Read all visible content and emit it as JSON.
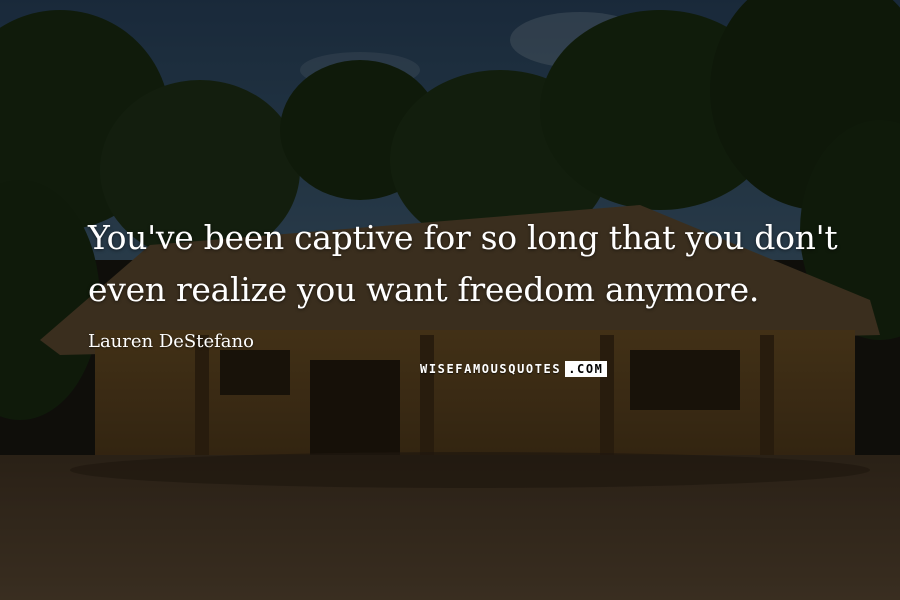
{
  "quote": {
    "text": "You've been captive for so long that you don't even realize you want freedom anymore.",
    "author": "Lauren DeStefano"
  },
  "watermark": {
    "site": "WISEFAMOUSQUOTES",
    "tld": ".COM"
  },
  "colors": {
    "text": "#ffffff",
    "sky": "#3a5a78",
    "foliage": "#223a1a",
    "hut_wall": "#6e5226",
    "ground": "#5a4630"
  }
}
